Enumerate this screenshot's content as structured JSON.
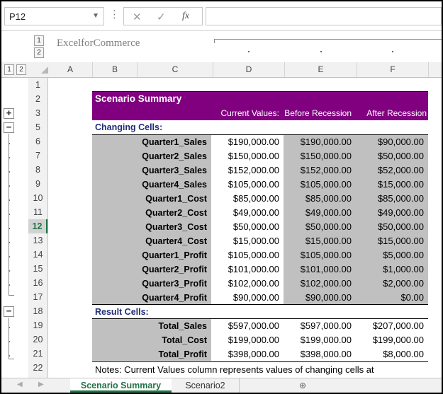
{
  "formula_bar": {
    "name_box": "P12",
    "cancel_glyph": "✕",
    "enter_glyph": "✓",
    "fx_label": "fx",
    "formula": ""
  },
  "outline": {
    "col_levels": [
      "1",
      "2"
    ],
    "row_levels": [
      "1",
      "2"
    ],
    "expand_glyph": "+",
    "collapse_glyph": "−"
  },
  "watermark": "ExcelforCommerce",
  "columns": [
    "A",
    "B",
    "C",
    "D",
    "E",
    "F"
  ],
  "rows": [
    "1",
    "2",
    "3",
    "5",
    "6",
    "7",
    "8",
    "9",
    "10",
    "11",
    "12",
    "13",
    "14",
    "15",
    "16",
    "17",
    "18",
    "19",
    "20",
    "21",
    "22"
  ],
  "active_row": "12",
  "summary": {
    "title": "Scenario Summary",
    "headers": [
      "Current Values:",
      "Before Recession",
      "After Recession"
    ],
    "changing_label": "Changing Cells:",
    "changing": [
      {
        "name": "Quarter1_Sales",
        "values": [
          "$190,000.00",
          "$190,000.00",
          "$90,000.00"
        ]
      },
      {
        "name": "Quarter2_Sales",
        "values": [
          "$150,000.00",
          "$150,000.00",
          "$50,000.00"
        ]
      },
      {
        "name": "Quarter3_Sales",
        "values": [
          "$152,000.00",
          "$152,000.00",
          "$52,000.00"
        ]
      },
      {
        "name": "Quarter4_Sales",
        "values": [
          "$105,000.00",
          "$105,000.00",
          "$15,000.00"
        ]
      },
      {
        "name": "Quarter1_Cost",
        "values": [
          "$85,000.00",
          "$85,000.00",
          "$85,000.00"
        ]
      },
      {
        "name": "Quarter2_Cost",
        "values": [
          "$49,000.00",
          "$49,000.00",
          "$49,000.00"
        ]
      },
      {
        "name": "Quarter3_Cost",
        "values": [
          "$50,000.00",
          "$50,000.00",
          "$50,000.00"
        ]
      },
      {
        "name": "Quarter4_Cost",
        "values": [
          "$15,000.00",
          "$15,000.00",
          "$15,000.00"
        ]
      },
      {
        "name": "Quarter1_Profit",
        "values": [
          "$105,000.00",
          "$105,000.00",
          "$5,000.00"
        ]
      },
      {
        "name": "Quarter2_Profit",
        "values": [
          "$101,000.00",
          "$101,000.00",
          "$1,000.00"
        ]
      },
      {
        "name": "Quarter3_Profit",
        "values": [
          "$102,000.00",
          "$102,000.00",
          "$2,000.00"
        ]
      },
      {
        "name": "Quarter4_Profit",
        "values": [
          "$90,000.00",
          "$90,000.00",
          "$0.00"
        ]
      }
    ],
    "result_label": "Result Cells:",
    "results": [
      {
        "name": "Total_Sales",
        "values": [
          "$597,000.00",
          "$597,000.00",
          "$207,000.00"
        ]
      },
      {
        "name": "Total_Cost",
        "values": [
          "$199,000.00",
          "$199,000.00",
          "$199,000.00"
        ]
      },
      {
        "name": "Total_Profit",
        "values": [
          "$398,000.00",
          "$398,000.00",
          "$8,000.00"
        ]
      }
    ],
    "notes": "Notes:  Current Values column represents values of changing cells at"
  },
  "tabs": {
    "prev_glyph": "◀",
    "next_glyph": "▶",
    "items": [
      "Scenario Summary",
      "Scenario2"
    ],
    "add_glyph": "⊕"
  },
  "colors": {
    "header_fill": "#800080",
    "gray_fill": "#c0c0c0",
    "section_text": "#1f2d7a",
    "active_tab": "#217346"
  }
}
